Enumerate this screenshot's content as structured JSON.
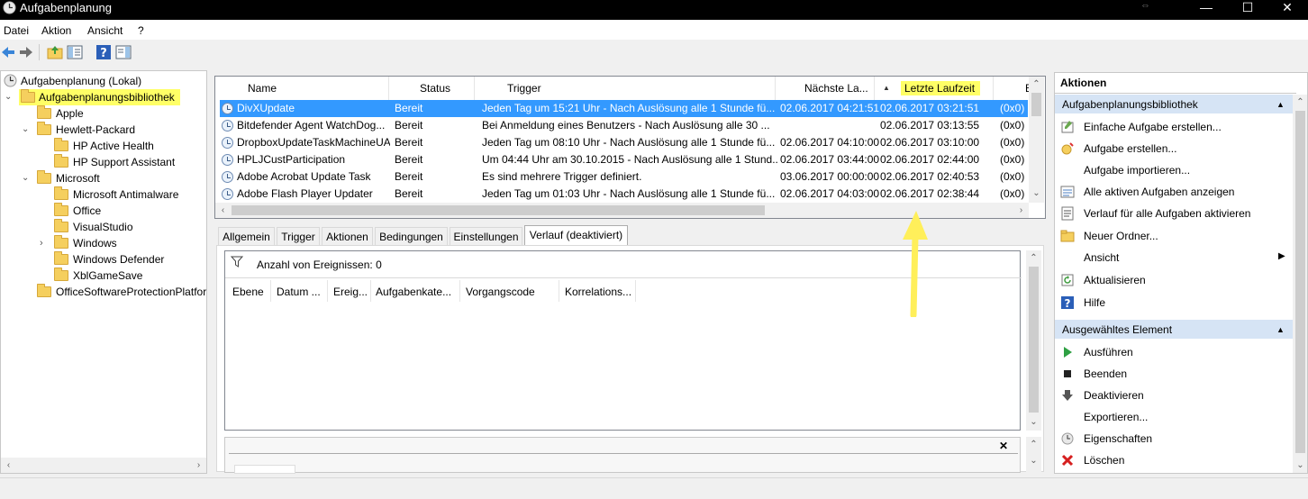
{
  "window": {
    "title": "Aufgabenplanung",
    "minimize": "—",
    "maximize": "☐",
    "close": "✕"
  },
  "menu": [
    "Datei",
    "Aktion",
    "Ansicht",
    "?"
  ],
  "tree": {
    "root": "Aufgabenplanung (Lokal)",
    "library": "Aufgabenplanungsbibliothek",
    "items": [
      {
        "label": "Apple"
      },
      {
        "label": "Hewlett-Packard"
      },
      {
        "label": "HP Active Health"
      },
      {
        "label": "HP Support Assistant"
      },
      {
        "label": "Microsoft"
      },
      {
        "label": "Microsoft Antimalware"
      },
      {
        "label": "Office"
      },
      {
        "label": "VisualStudio"
      },
      {
        "label": "Windows"
      },
      {
        "label": "Windows Defender"
      },
      {
        "label": "XblGameSave"
      },
      {
        "label": "OfficeSoftwareProtectionPlatfor"
      }
    ]
  },
  "tasks": {
    "columns": [
      "Name",
      "Status",
      "Trigger",
      "Nächste La...",
      "Letzte Laufzeit",
      "E"
    ],
    "sort_indicator": "▲",
    "rows": [
      {
        "name": "DivXUpdate",
        "status": "Bereit",
        "trigger": "Jeden Tag um 15:21 Uhr - Nach Auslösung alle 1 Stunde fü...",
        "next": "02.06.2017 04:21:51",
        "last": "02.06.2017 03:21:51",
        "result": "(0x0)"
      },
      {
        "name": "Bitdefender Agent WatchDog...",
        "status": "Bereit",
        "trigger": "Bei Anmeldung eines Benutzers - Nach Auslösung alle 30 ...",
        "next": "",
        "last": "02.06.2017 03:13:55",
        "result": "(0x0)"
      },
      {
        "name": "DropboxUpdateTaskMachineUA",
        "status": "Bereit",
        "trigger": "Jeden Tag um 08:10 Uhr - Nach Auslösung alle 1 Stunde fü...",
        "next": "02.06.2017 04:10:00",
        "last": "02.06.2017 03:10:00",
        "result": "(0x0)"
      },
      {
        "name": "HPLJCustParticipation",
        "status": "Bereit",
        "trigger": "Um 04:44 Uhr am 30.10.2015 - Nach Auslösung alle 1 Stund...",
        "next": "02.06.2017 03:44:00",
        "last": "02.06.2017 02:44:00",
        "result": "(0x0)"
      },
      {
        "name": "Adobe Acrobat Update Task",
        "status": "Bereit",
        "trigger": "Es sind mehrere Trigger definiert.",
        "next": "03.06.2017 00:00:00",
        "last": "02.06.2017 02:40:53",
        "result": "(0x0)"
      },
      {
        "name": "Adobe Flash Player Updater",
        "status": "Bereit",
        "trigger": "Jeden Tag um 01:03 Uhr - Nach Auslösung alle 1 Stunde fü...",
        "next": "02.06.2017 04:03:00",
        "last": "02.06.2017 02:38:44",
        "result": "(0x0)"
      }
    ]
  },
  "tabs": [
    "Allgemein",
    "Trigger",
    "Aktionen",
    "Bedingungen",
    "Einstellungen",
    "Verlauf (deaktiviert)"
  ],
  "history": {
    "event_count": "Anzahl von Ereignissen: 0",
    "columns": [
      "Ebene",
      "Datum ...",
      "Ereig...",
      "Aufgabenkate...",
      "Vorgangscode",
      "Korrelations..."
    ],
    "close": "✕"
  },
  "actions": {
    "header": "Aktionen",
    "section1": "Aufgabenplanungsbibliothek",
    "items1": [
      "Einfache Aufgabe erstellen...",
      "Aufgabe erstellen...",
      "Aufgabe importieren...",
      "Alle aktiven Aufgaben anzeigen",
      "Verlauf für alle Aufgaben aktivieren",
      "Neuer Ordner...",
      "Ansicht",
      "Aktualisieren",
      "Hilfe"
    ],
    "section2": "Ausgewähltes Element",
    "items2": [
      "Ausführen",
      "Beenden",
      "Deaktivieren",
      "Exportieren...",
      "Eigenschaften",
      "Löschen"
    ]
  },
  "colors": {
    "highlight": "#ffff66",
    "selection": "#3399ff",
    "action_header": "#d6e4f5",
    "annotation_arrow": "#ffef5a"
  }
}
